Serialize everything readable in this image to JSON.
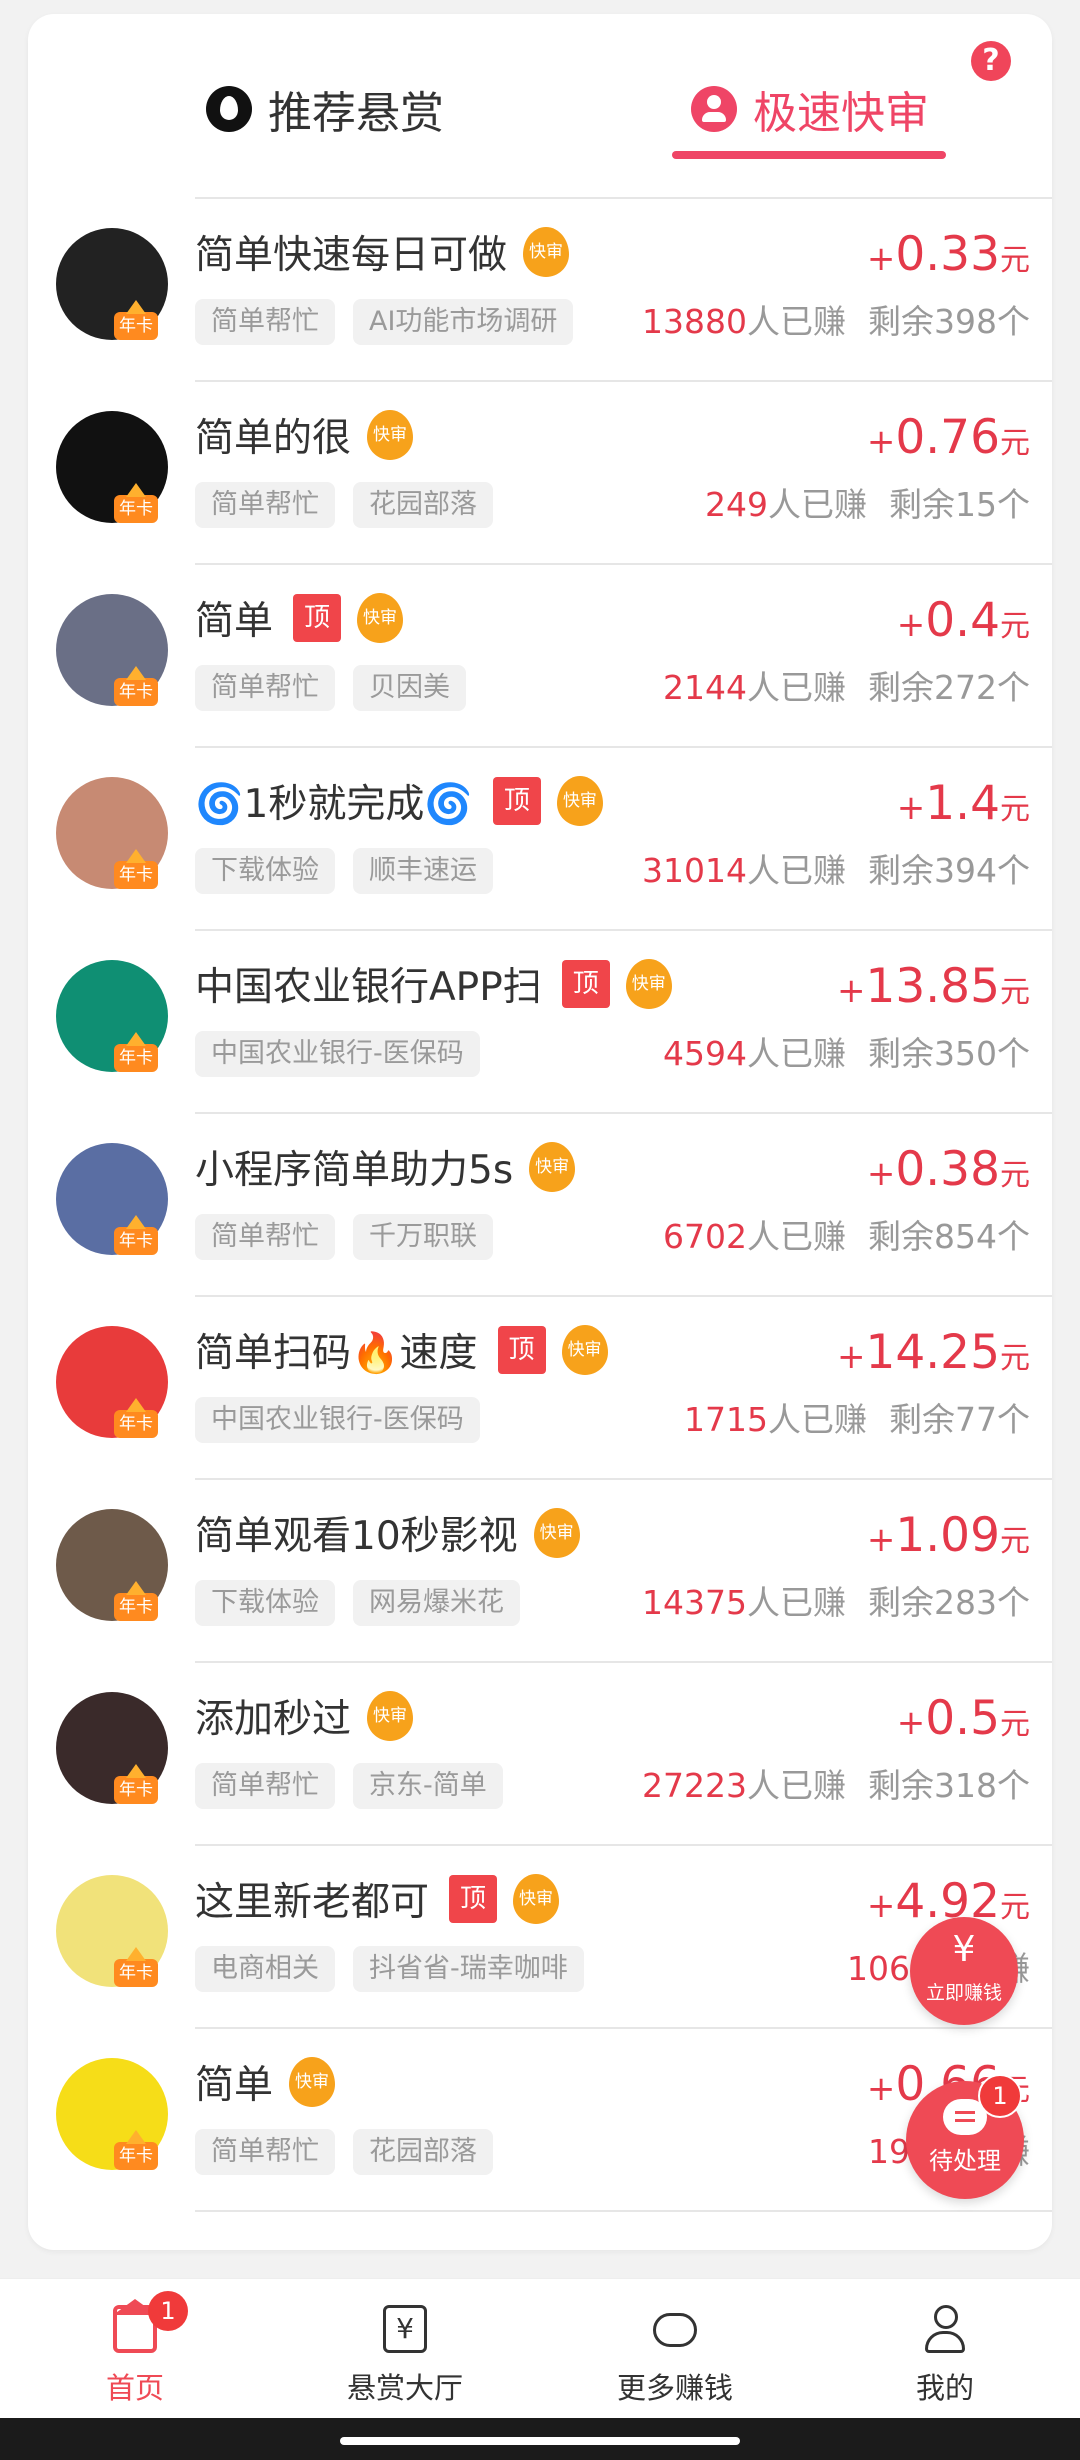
{
  "tabs": {
    "recommend": "推荐悬赏",
    "fast": "极速快审"
  },
  "help_icon": "?",
  "badges": {
    "top": "顶",
    "fast": "快审",
    "annual": "年卡"
  },
  "currency_unit": "元",
  "stat_labels": {
    "earned": "人已赚",
    "remain_prefix": "剩余",
    "remain_suffix": "个"
  },
  "tasks": [
    {
      "title": "简单快速每日可做",
      "top": false,
      "fast": true,
      "price": "0.33",
      "tags": [
        "简单帮忙",
        "AI功能市场调研"
      ],
      "earned": "13880",
      "remain": "398",
      "avatar_color": "#222222"
    },
    {
      "title": "简单的很",
      "top": false,
      "fast": true,
      "price": "0.76",
      "tags": [
        "简单帮忙",
        "花园部落"
      ],
      "earned": "249",
      "remain": "15",
      "avatar_color": "#111111"
    },
    {
      "title": "简单",
      "top": true,
      "fast": true,
      "price": "0.4",
      "tags": [
        "简单帮忙",
        "贝因美"
      ],
      "earned": "2144",
      "remain": "272",
      "avatar_color": "#6a6f86"
    },
    {
      "title": "🌀1秒就完成🌀",
      "top": true,
      "fast": true,
      "price": "1.4",
      "tags": [
        "下载体验",
        "顺丰速运"
      ],
      "earned": "31014",
      "remain": "394",
      "avatar_color": "#c78a73"
    },
    {
      "title": "中国农业银行APP扫",
      "top": true,
      "fast": true,
      "price": "13.85",
      "tags": [
        "中国农业银行-医保码"
      ],
      "earned": "4594",
      "remain": "350",
      "avatar_color": "#0f8f73"
    },
    {
      "title": "小程序简单助力5s",
      "top": false,
      "fast": true,
      "price": "0.38",
      "tags": [
        "简单帮忙",
        "千万职联"
      ],
      "earned": "6702",
      "remain": "854",
      "avatar_color": "#5a6ea3"
    },
    {
      "title": "简单扫码🔥速度",
      "top": true,
      "fast": true,
      "price": "14.25",
      "tags": [
        "中国农业银行-医保码"
      ],
      "earned": "1715",
      "remain": "77",
      "avatar_color": "#e83b3b"
    },
    {
      "title": "简单观看10秒影视",
      "top": false,
      "fast": true,
      "price": "1.09",
      "tags": [
        "下载体验",
        "网易爆米花"
      ],
      "earned": "14375",
      "remain": "283",
      "avatar_color": "#6e5a4a"
    },
    {
      "title": "添加秒过",
      "top": false,
      "fast": true,
      "price": "0.5",
      "tags": [
        "简单帮忙",
        "京东-简单"
      ],
      "earned": "27223",
      "remain": "318",
      "avatar_color": "#3a2a2a"
    },
    {
      "title": "这里新老都可",
      "top": true,
      "fast": true,
      "price": "4.92",
      "tags": [
        "电商相关",
        "抖省省-瑞幸咖啡"
      ],
      "earned": "1067",
      "remain": "",
      "avatar_color": "#f1e27a"
    },
    {
      "title": "简单",
      "top": false,
      "fast": true,
      "price": "0.66",
      "tags": [
        "简单帮忙",
        "花园部落"
      ],
      "earned": "196",
      "remain": "",
      "avatar_color": "#f6dd18"
    }
  ],
  "float_buttons": {
    "earn_label": "立即赚钱",
    "earn_glyph": "¥",
    "pending_label": "待处理",
    "pending_count": "1"
  },
  "tabbar": {
    "home": "首页",
    "home_badge": "1",
    "hall": "悬赏大厅",
    "hall_glyph": "¥",
    "more": "更多赚钱",
    "mine": "我的"
  },
  "colors": {
    "accent": "#ef4566",
    "price": "#e4394a",
    "top_tag": "#f0454a",
    "fast_tag": "#f7a21b"
  }
}
